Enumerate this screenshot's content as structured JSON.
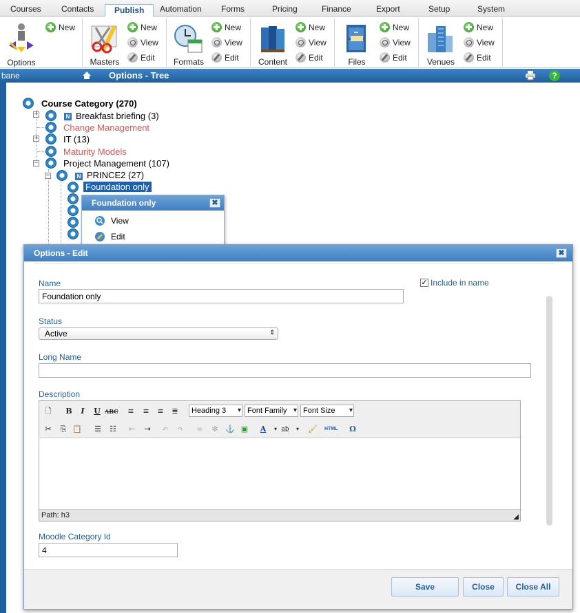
{
  "tabs": [
    "Courses",
    "Contacts",
    "Publish",
    "Automation",
    "Forms",
    "Pricing",
    "Finance",
    "Export",
    "Setup",
    "System"
  ],
  "ribbon": {
    "options_label": "Options",
    "new": "New",
    "view": "View",
    "edit": "Edit",
    "groups": [
      "Masters",
      "Formats",
      "Content",
      "Files",
      "Venues"
    ]
  },
  "titlebar": {
    "left": "bane",
    "title": "Options - Tree"
  },
  "tree": {
    "root": "Course Category (270)",
    "items": [
      "Breakfast briefing (3)",
      "Change Management",
      "IT (13)",
      "Maturity Models",
      "Project Management (107)",
      "PRINCE2 (27)",
      "Foundation only"
    ],
    "badge": "N"
  },
  "context_menu": {
    "title": "Foundation only",
    "view": "View",
    "edit": "Edit"
  },
  "dialog": {
    "title": "Options - Edit",
    "name_label": "Name",
    "name_value": "Foundation only",
    "include_in_name": "Include in name",
    "status_label": "Status",
    "status_value": "Active",
    "long_name_label": "Long Name",
    "long_name_value": "",
    "description_label": "Description",
    "editor": {
      "heading": "Heading 3",
      "font_family": "Font Family",
      "font_size": "Font Size",
      "path": "Path: h3",
      "html_btn": "HTML"
    },
    "moodle_label": "Moodle Category Id",
    "moodle_value": "4",
    "save": "Save",
    "close": "Close",
    "close_all": "Close All"
  },
  "colors": {
    "accent": "#1f5f9f",
    "link_red": "#e0534f"
  }
}
